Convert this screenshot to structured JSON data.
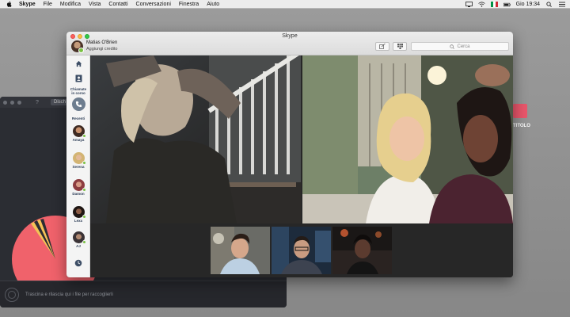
{
  "menubar": {
    "apple_icon": "apple-icon",
    "items": [
      "Skype",
      "File",
      "Modifica",
      "Vista",
      "Contatti",
      "Conversazioni",
      "Finestra",
      "Aiuto"
    ],
    "clock": "Gio 19:34"
  },
  "skype": {
    "title": "Skype",
    "user_name": "Matias O'Brien",
    "credit_label": "Aggiungi credito",
    "search_placeholder": "Cerca",
    "sidebar": {
      "ongoing_call_label_1": "Chiamate",
      "ongoing_call_label_2": "in corso",
      "recent_label": "Recenti",
      "contacts": [
        {
          "name": "Amaya"
        },
        {
          "name": "Serena"
        },
        {
          "name": "Damon"
        },
        {
          "name": "Lexx"
        },
        {
          "name": "AJ"
        }
      ]
    }
  },
  "background_app": {
    "tab_label": "Disch",
    "drop_hint": "Trascina e rilascia qui i file per raccoglierli",
    "side_item_label": "TITOLO"
  },
  "colors": {
    "accent_pink": "#f0626b",
    "status_online": "#7ac142",
    "skype_sidebar_text": "#2a3b55"
  }
}
